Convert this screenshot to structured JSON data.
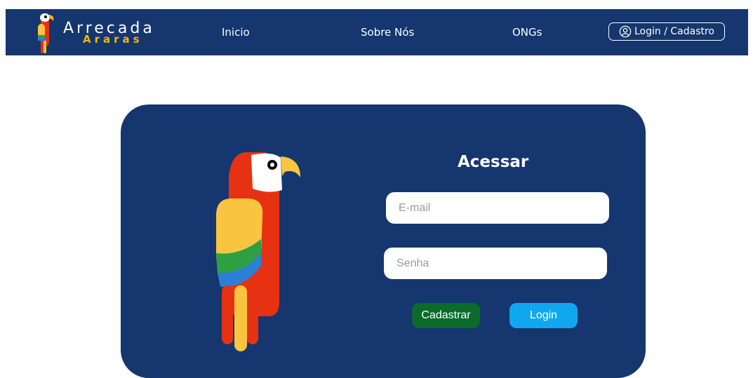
{
  "brand": {
    "name": "Arrecada",
    "sub": "Araras"
  },
  "nav": {
    "items": [
      {
        "label": "Inicio"
      },
      {
        "label": "Sobre Nós"
      },
      {
        "label": "ONGs"
      }
    ],
    "login_label": "Login / Cadastro"
  },
  "login_form": {
    "title": "Acessar",
    "email_placeholder": "E-mail",
    "password_placeholder": "Senha",
    "register_label": "Cadastrar",
    "login_label": "Login"
  },
  "colors": {
    "navy": "#15366e",
    "register_green": "#0b6b2a",
    "login_blue": "#10a7f0",
    "brand_yellow": "#f2b705",
    "parrot_red": "#e63212",
    "parrot_yellow": "#f9c440",
    "parrot_green": "#2ea043",
    "parrot_blue": "#2b7fd6"
  },
  "icons": [
    "parrot-logo-icon",
    "user-icon",
    "parrot-illustration"
  ]
}
